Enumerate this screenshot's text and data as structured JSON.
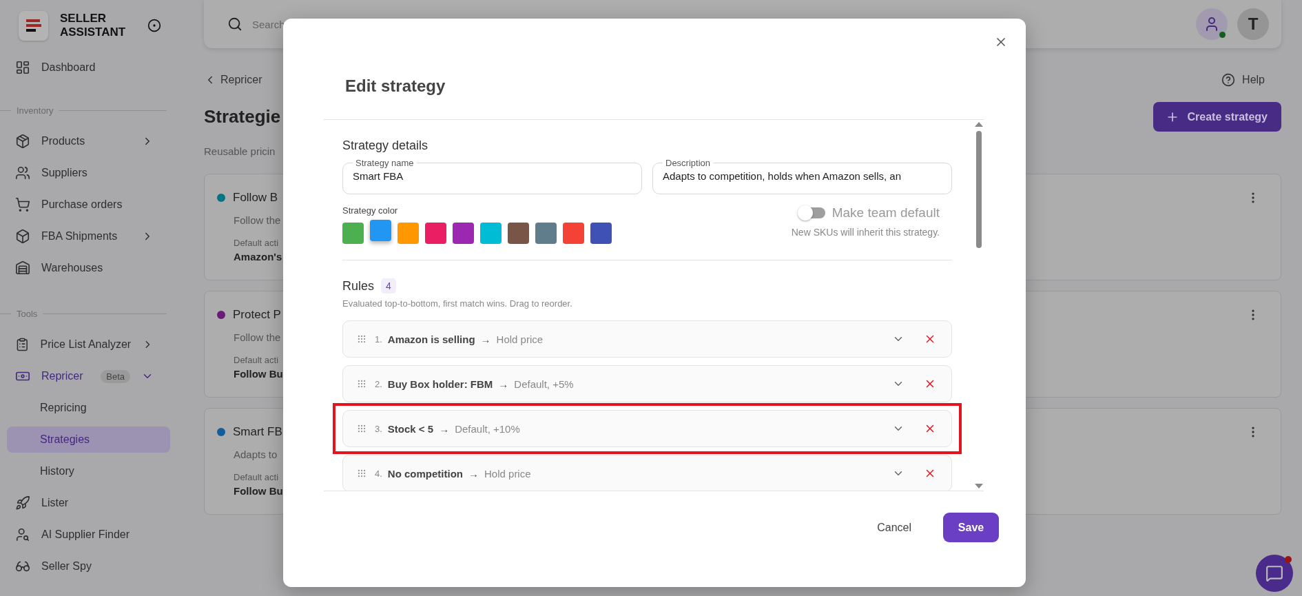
{
  "sidebar": {
    "brand": "SELLER ASSISTANT",
    "items": [
      {
        "kind": "item",
        "label": "Dashboard",
        "selected": false
      },
      {
        "kind": "section",
        "label": "Inventory"
      },
      {
        "kind": "item",
        "label": "Products",
        "selected": false,
        "expanded": false
      },
      {
        "kind": "item",
        "label": "Suppliers",
        "selected": false
      },
      {
        "kind": "item",
        "label": "Purchase orders",
        "selected": false
      },
      {
        "kind": "item",
        "label": "FBA Shipments",
        "selected": false,
        "expanded": false
      },
      {
        "kind": "item",
        "label": "Warehouses",
        "selected": false
      },
      {
        "kind": "section",
        "label": "Tools"
      },
      {
        "kind": "item",
        "label": "Price List Analyzer",
        "selected": false,
        "expanded": false
      },
      {
        "kind": "item",
        "label": "Repricer",
        "selected": false,
        "expanded": true,
        "badge": "Beta"
      },
      {
        "kind": "subitem",
        "label": "Repricing",
        "selected": false
      },
      {
        "kind": "subitem",
        "label": "Strategies",
        "selected": true
      },
      {
        "kind": "subitem",
        "label": "History",
        "selected": false
      },
      {
        "kind": "item",
        "label": "Lister",
        "selected": false
      },
      {
        "kind": "item",
        "label": "AI Supplier Finder",
        "selected": false
      },
      {
        "kind": "item",
        "label": "Seller Spy",
        "selected": false
      }
    ]
  },
  "header": {
    "search": {
      "placeholder": "Search"
    },
    "user_online": true,
    "avatar": "T"
  },
  "page": {
    "back": "Repricer",
    "help": "Help",
    "title": "Strategie",
    "subtitle": "Reusable pricin",
    "create_button": "Create strategy",
    "cards": [
      {
        "title": "Follow B",
        "color": "#007583",
        "description": "Follow the",
        "default_label": "Default acti",
        "default_value": "Amazon's"
      },
      {
        "title": "Protect P",
        "color": "#6a1a78",
        "description": "Follow the",
        "default_label": "Default acti",
        "default_value": "Follow Bu"
      },
      {
        "title": "Smart FB",
        "color": "#145d9c",
        "description": "Adapts to",
        "default_label": "Default acti",
        "default_value": "Follow Bu"
      }
    ]
  },
  "dialog": {
    "title": "Edit strategy",
    "section_title": "Strategy details",
    "name_field": {
      "label": "Strategy name",
      "value": "Smart FBA"
    },
    "description_field": {
      "label": "Description",
      "value": "Adapts to competition, holds when Amazon sells, an"
    },
    "color_label": "Strategy color",
    "colors": [
      {
        "color": "#4caf50",
        "selected": false
      },
      {
        "color": "#2196f3",
        "selected": true
      },
      {
        "color": "#ff9800",
        "selected": false
      },
      {
        "color": "#e91e63",
        "selected": false
      },
      {
        "color": "#9c27b0",
        "selected": false
      },
      {
        "color": "#00bcd4",
        "selected": false
      },
      {
        "color": "#795548",
        "selected": false
      },
      {
        "color": "#607d8b",
        "selected": false
      },
      {
        "color": "#f44336",
        "selected": false
      },
      {
        "color": "#3f51b5",
        "selected": false
      }
    ],
    "team_default": {
      "label": "Make team default",
      "on": false,
      "hint": "New SKUs will inherit this strategy."
    },
    "rules_title": "Rules",
    "rules_count": "4",
    "rules_hint": "Evaluated top-to-bottom, first match wins. Drag to reorder.",
    "rules": [
      {
        "number": "1.",
        "condition": "Amazon is selling",
        "arrow": "→",
        "action": "Hold price",
        "highlighted": false
      },
      {
        "number": "2.",
        "condition": "Buy Box holder: FBM",
        "arrow": "→",
        "action": "Default, +5%",
        "highlighted": false
      },
      {
        "number": "3.",
        "condition": "Stock < 5",
        "arrow": "→",
        "action": "Default, +10%",
        "highlighted": true
      },
      {
        "number": "4.",
        "condition": "No competition",
        "arrow": "→",
        "action": "Hold price",
        "highlighted": false
      }
    ],
    "cancel": "Cancel",
    "save": "Save"
  },
  "chat": {
    "unread": true
  }
}
